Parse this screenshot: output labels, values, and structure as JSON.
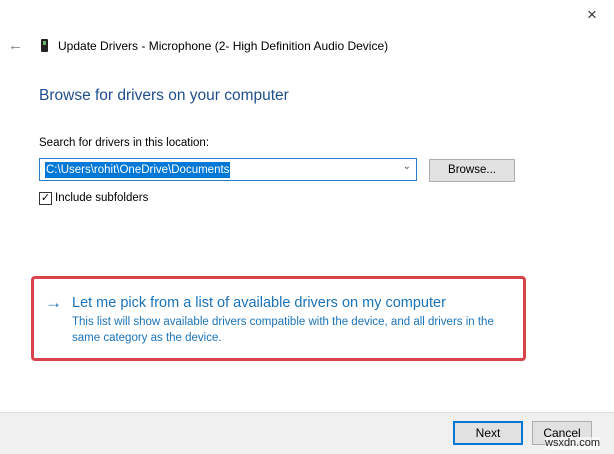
{
  "window": {
    "title": "Update Drivers - Microphone (2- High Definition Audio Device)",
    "close_icon": "×",
    "back_icon": "←"
  },
  "main": {
    "heading": "Browse for drivers on your computer",
    "search_label": "Search for drivers in this location:",
    "path_value": "C:\\Users\\rohit\\OneDrive\\Documents",
    "chevron": "⌄",
    "browse_label": "Browse...",
    "include_subfolders_label": "Include subfolders",
    "include_subfolders_checked": true,
    "check_glyph": "✓",
    "pick_arrow": "→",
    "pick_link": "Let me pick from a list of available drivers on my computer",
    "pick_description": "This list will show available drivers compatible with the device, and all drivers in the same category as the device."
  },
  "footer": {
    "next_label": "Next",
    "cancel_label": "Cancel"
  },
  "watermark": "wsxdn.com",
  "colors": {
    "accent": "#0078d7",
    "link": "#1a73b8",
    "heading": "#1f4e8c",
    "highlight_box": "#d9434a"
  }
}
